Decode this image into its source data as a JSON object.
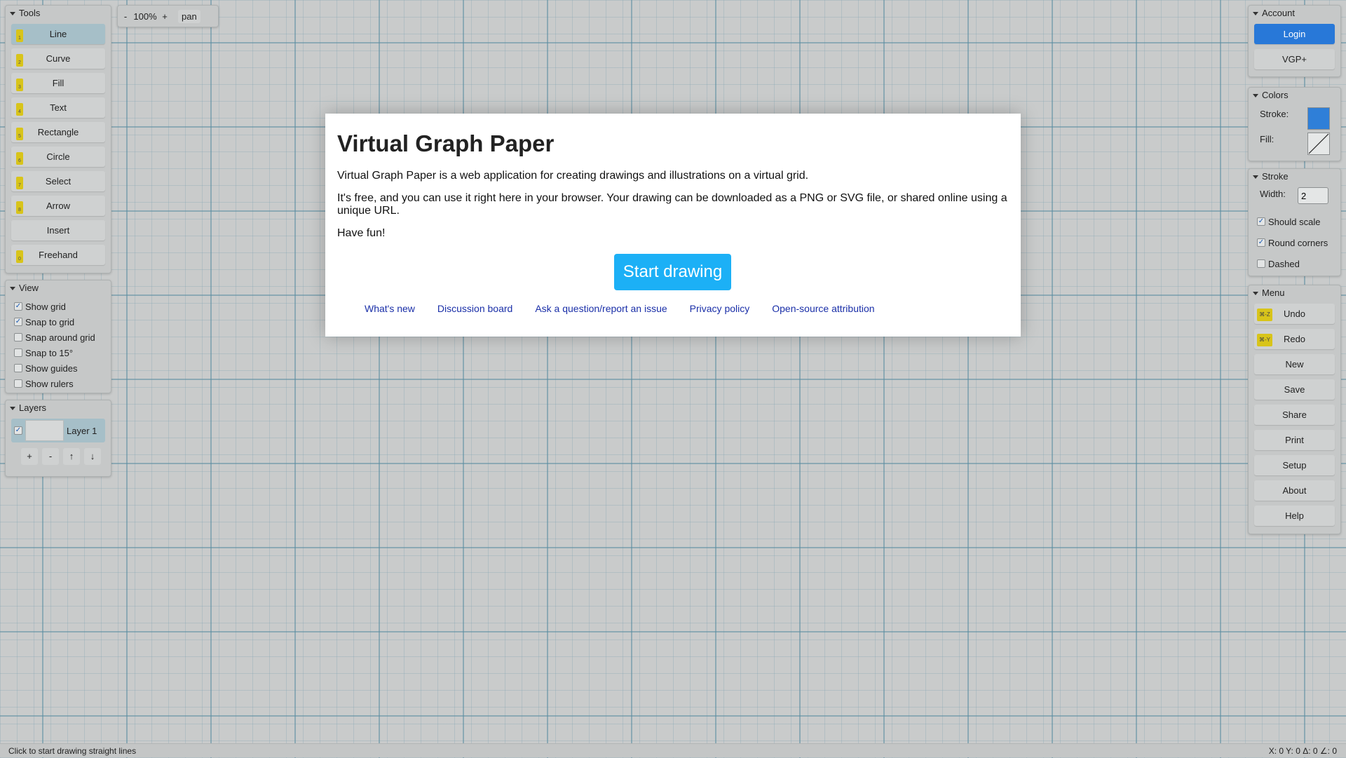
{
  "tools": {
    "title": "Tools",
    "items": [
      {
        "label": "Line",
        "key": "1",
        "active": true
      },
      {
        "label": "Curve",
        "key": "2"
      },
      {
        "label": "Fill",
        "key": "3"
      },
      {
        "label": "Text",
        "key": "4"
      },
      {
        "label": "Rectangle",
        "key": "5"
      },
      {
        "label": "Circle",
        "key": "6"
      },
      {
        "label": "Select",
        "key": "7"
      },
      {
        "label": "Arrow",
        "key": "8"
      },
      {
        "label": "Insert",
        "key": ""
      },
      {
        "label": "Freehand",
        "key": "0"
      }
    ]
  },
  "zoom": {
    "minus": "-",
    "value": "100%",
    "plus": "+",
    "pan": "pan"
  },
  "view": {
    "title": "View",
    "options": [
      {
        "label": "Show grid",
        "checked": true
      },
      {
        "label": "Snap to grid",
        "checked": true
      },
      {
        "label": "Snap around grid",
        "checked": false
      },
      {
        "label": "Snap to 15°",
        "checked": false
      },
      {
        "label": "Show guides",
        "checked": false
      },
      {
        "label": "Show rulers",
        "checked": false
      }
    ]
  },
  "layers": {
    "title": "Layers",
    "items": [
      {
        "label": "Layer 1",
        "checked": true
      }
    ],
    "controls": {
      "add": "+",
      "remove": "-",
      "up": "↑",
      "down": "↓"
    }
  },
  "account": {
    "title": "Account",
    "login": "Login",
    "vgp": "VGP+"
  },
  "colors": {
    "title": "Colors",
    "stroke_label": "Stroke:",
    "fill_label": "Fill:",
    "stroke_color": "#2f7fd8"
  },
  "stroke": {
    "title": "Stroke",
    "width_label": "Width:",
    "width_value": "2",
    "options": [
      {
        "label": "Should scale",
        "checked": true
      },
      {
        "label": "Round corners",
        "checked": true
      },
      {
        "label": "Dashed",
        "checked": false
      }
    ]
  },
  "menu": {
    "title": "Menu",
    "items": [
      {
        "label": "Undo",
        "key": "⌘-Z"
      },
      {
        "label": "Redo",
        "key": "⌘-Y"
      },
      {
        "label": "New",
        "key": ""
      },
      {
        "label": "Save",
        "key": ""
      },
      {
        "label": "Share",
        "key": ""
      },
      {
        "label": "Print",
        "key": ""
      },
      {
        "label": "Setup",
        "key": ""
      },
      {
        "label": "About",
        "key": ""
      },
      {
        "label": "Help",
        "key": ""
      }
    ]
  },
  "modal": {
    "title": "Virtual Graph Paper",
    "paragraphs": [
      "Virtual Graph Paper is a web application for creating drawings and illustrations on a virtual grid.",
      "It's free, and you can use it right here in your browser. Your drawing can be downloaded as a PNG or SVG file, or shared online using a unique URL.",
      "Have fun!"
    ],
    "start_button": "Start drawing",
    "links": [
      "What's new",
      "Discussion board",
      "Ask a question/report an issue",
      "Privacy policy",
      "Open-source attribution"
    ]
  },
  "status": {
    "hint": "Click to start drawing straight lines",
    "coords": "X: 0 Y: 0 Δ: 0 ∠: 0"
  }
}
